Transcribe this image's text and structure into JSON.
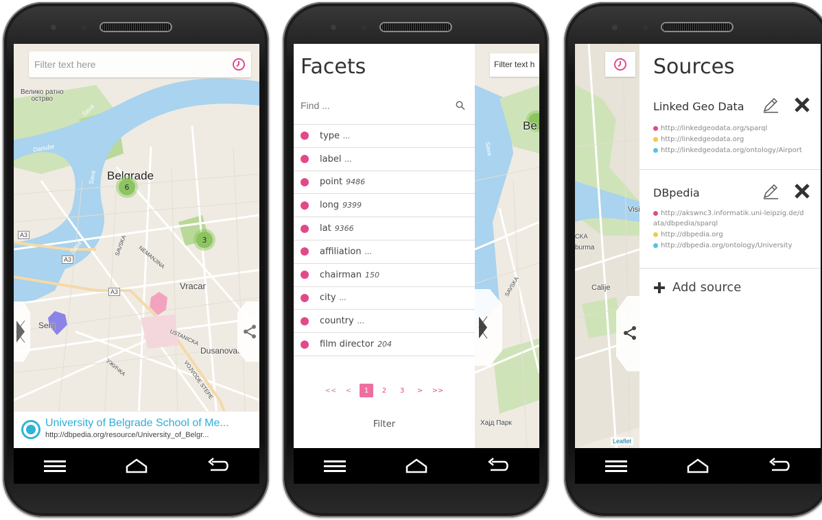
{
  "phone1": {
    "search": {
      "placeholder": "Filter text here"
    },
    "map_labels": {
      "veliko": "Велико ратно\nострво",
      "danube": "Danube",
      "sava1": "Sava",
      "sava2": "Sava",
      "sava3": "Sava",
      "belgrade": "Belgrade",
      "a3a": "A3",
      "a3b": "A3",
      "a3c": "A3",
      "savska": "SAVSKA",
      "nemanjina": "NEMANJINA",
      "vracar": "Vracar",
      "senjak": "Senj",
      "ustanicka": "USTANICKA",
      "dusanovac": "Dusanovac",
      "uzicka": "УЖИЧКА",
      "vojvode": "VOJVODE STEPE"
    },
    "clusters": [
      {
        "count": "6"
      },
      {
        "count": "3"
      }
    ],
    "result": {
      "title": "University of Belgrade School of Me...",
      "url": "http://dbpedia.org/resource/University_of_Belgr..."
    }
  },
  "phone2": {
    "title": "Facets",
    "find_placeholder": "Find ...",
    "facets": [
      {
        "label": "type",
        "count": "..."
      },
      {
        "label": "label",
        "count": "..."
      },
      {
        "label": "point",
        "count": "9486"
      },
      {
        "label": "long",
        "count": "9399"
      },
      {
        "label": "lat",
        "count": "9366"
      },
      {
        "label": "affiliation",
        "count": "..."
      },
      {
        "label": "chairman",
        "count": "150"
      },
      {
        "label": "city",
        "count": "..."
      },
      {
        "label": "country",
        "count": "..."
      },
      {
        "label": "film director",
        "count": "204"
      }
    ],
    "pager": {
      "first": "<<",
      "prev": "<",
      "pages": [
        "1",
        "2",
        "3"
      ],
      "next": ">",
      "last": ">>"
    },
    "filter_label": "Filter",
    "map_search_text": "Filter text h",
    "map_labels": {
      "be": "Be",
      "savska": "SAVSKA",
      "sava": "Sava",
      "park": "Хајд Парк"
    }
  },
  "phone3": {
    "title": "Sources",
    "sources": [
      {
        "name": "Linked Geo Data",
        "urls": [
          {
            "text": "http://linkedgeodata.org/sparql",
            "color": "#e2498a"
          },
          {
            "text": "http://linkedgeodata.org",
            "color": "#f2c94c"
          },
          {
            "text": "http://linkedgeodata.org/ontology/Airport",
            "color": "#56c1e8"
          }
        ]
      },
      {
        "name": "DBpedia",
        "urls": [
          {
            "text": "http://akswnc3.informatik.uni-leipzig.de/d",
            "color": "#e2498a"
          },
          {
            "text": "ata/dbpedia/sparql",
            "color": ""
          },
          {
            "text": "http://dbpedia.org",
            "color": "#f2c94c"
          },
          {
            "text": "http://dbpedia.org/ontology/University",
            "color": "#56c1e8"
          }
        ]
      }
    ],
    "add_source": "Add source",
    "map_labels": {
      "visi": "Visi",
      "cka": "CKA",
      "burma": "burma",
      "calije": "Calije",
      "leaflet": "Leaflet"
    }
  },
  "colors": {
    "accent_pink": "#e2498a",
    "accent_cyan": "#2ab0d9",
    "cluster_green": "#8cc461"
  }
}
